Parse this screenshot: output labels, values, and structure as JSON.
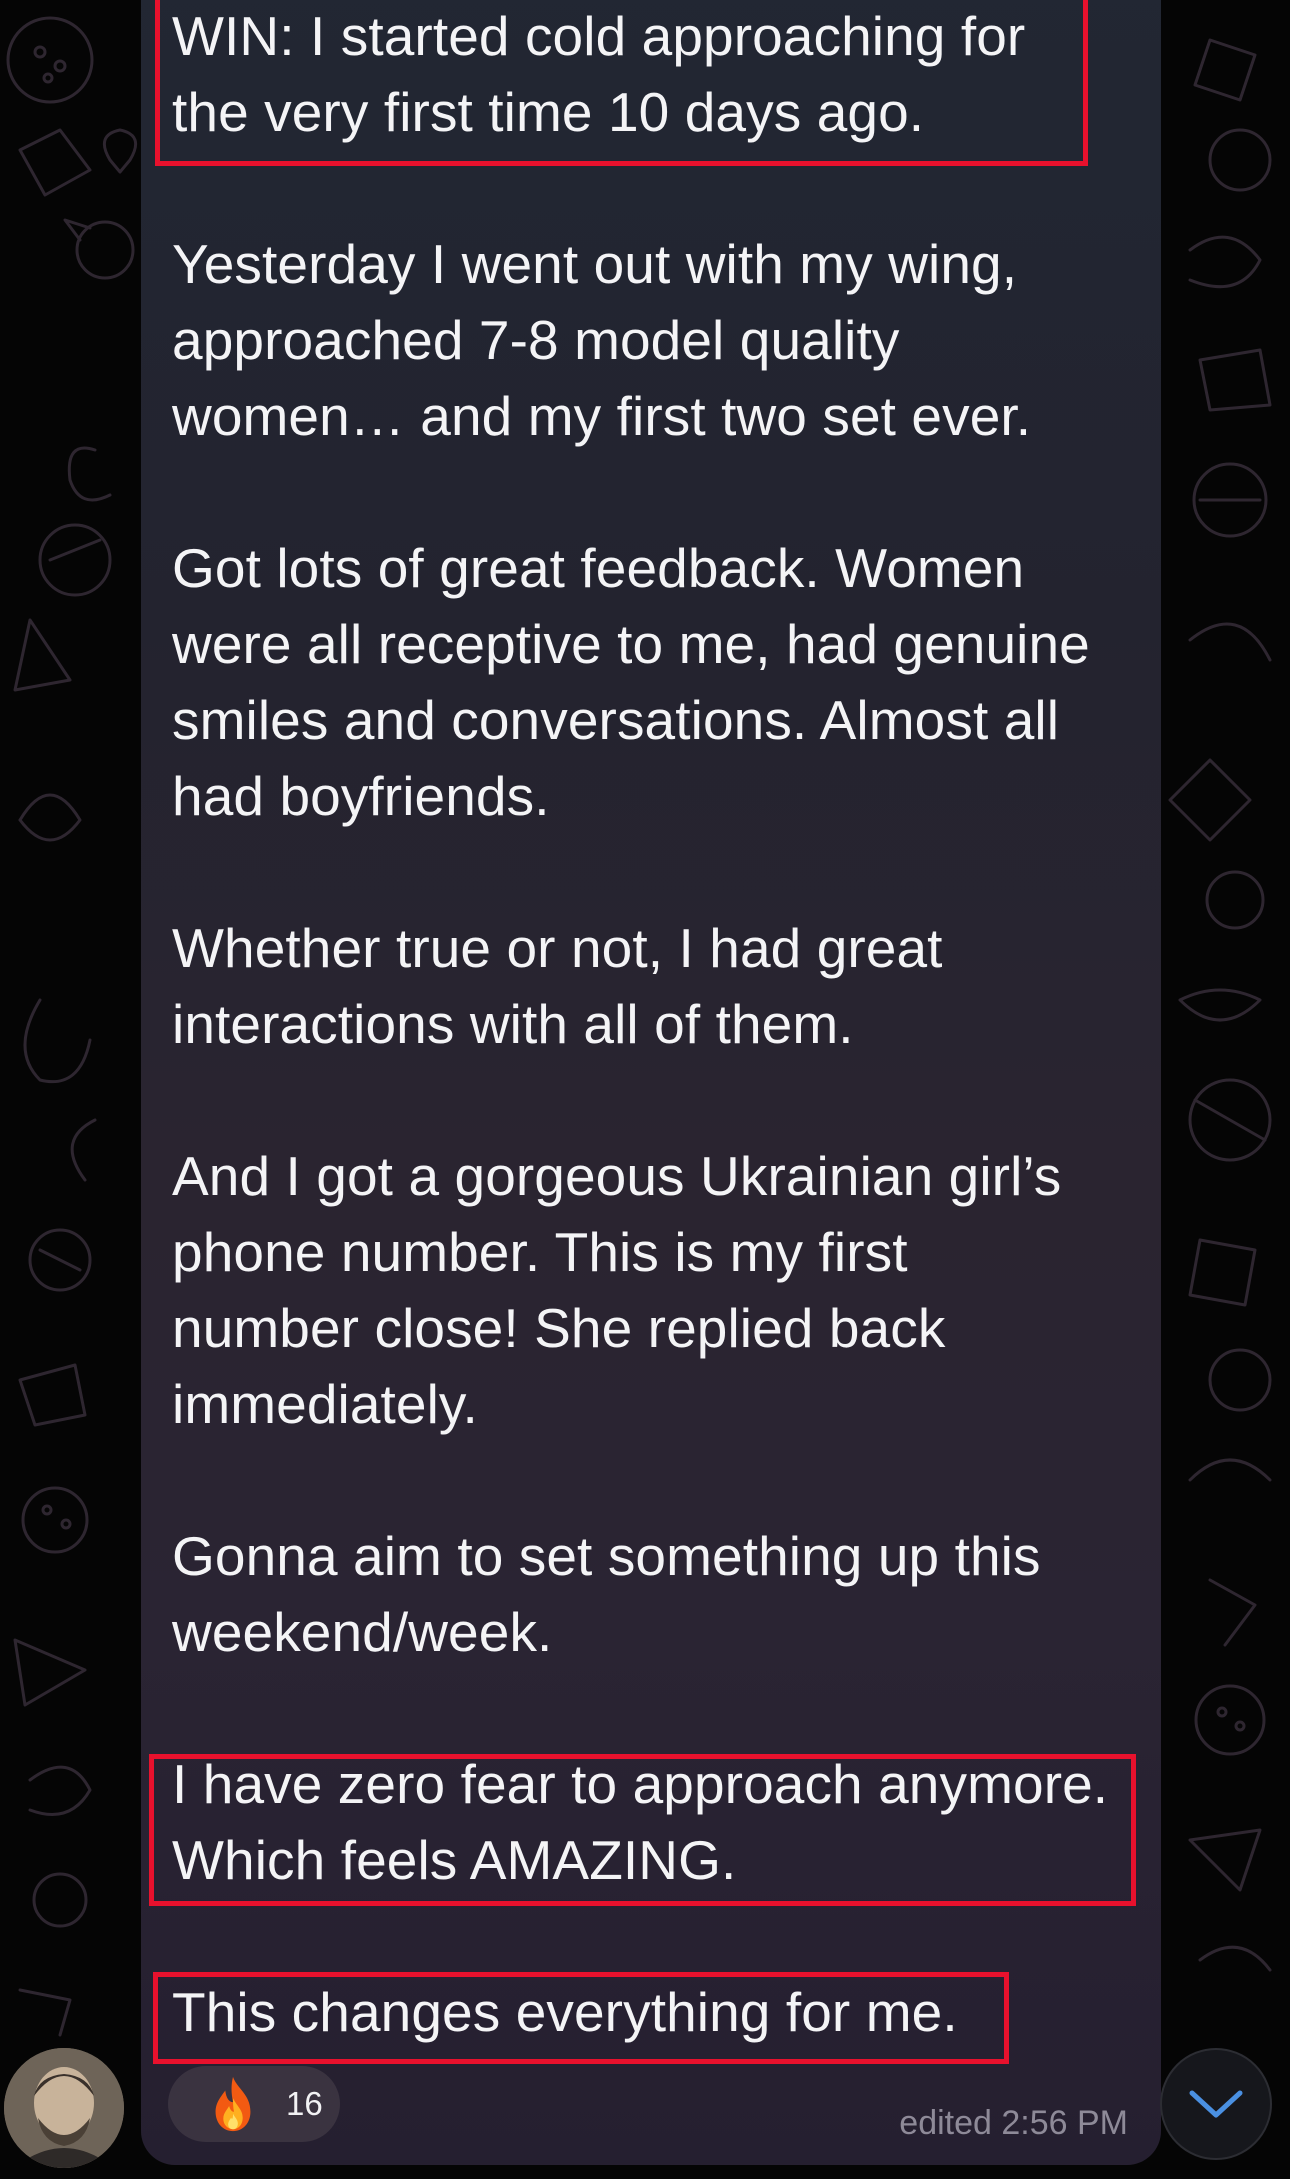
{
  "message": {
    "lines": [
      "WIN: I started cold approaching for",
      "the very first time 10 days ago.",
      "Yesterday I went out with my wing,",
      "approached 7-8 model quality",
      "women… and my first two set ever.",
      "Got lots of great feedback. Women",
      "were all receptive to me, had genuine",
      "smiles and conversations. Almost all",
      "had boyfriends.",
      "Whether true or not, I had great",
      "interactions with all of them.",
      "And I got a gorgeous Ukrainian girl’s",
      "phone number. This is my first",
      "number close! She replied back",
      "immediately.",
      "Gonna aim to set something up this",
      "weekend/week.",
      "I have zero fear to approach anymore.",
      "Which feels AMAZING.",
      "This changes everything for me."
    ],
    "edited_label": "edited 2:56 PM"
  },
  "reaction": {
    "emoji": "fire-icon",
    "count": "16"
  },
  "scroll_button": {
    "icon": "chevron-down-icon"
  },
  "colors": {
    "highlight": "#e8112d",
    "accent": "#4a90e2",
    "text": "#f4f4f6",
    "meta": "#8e8a98"
  }
}
